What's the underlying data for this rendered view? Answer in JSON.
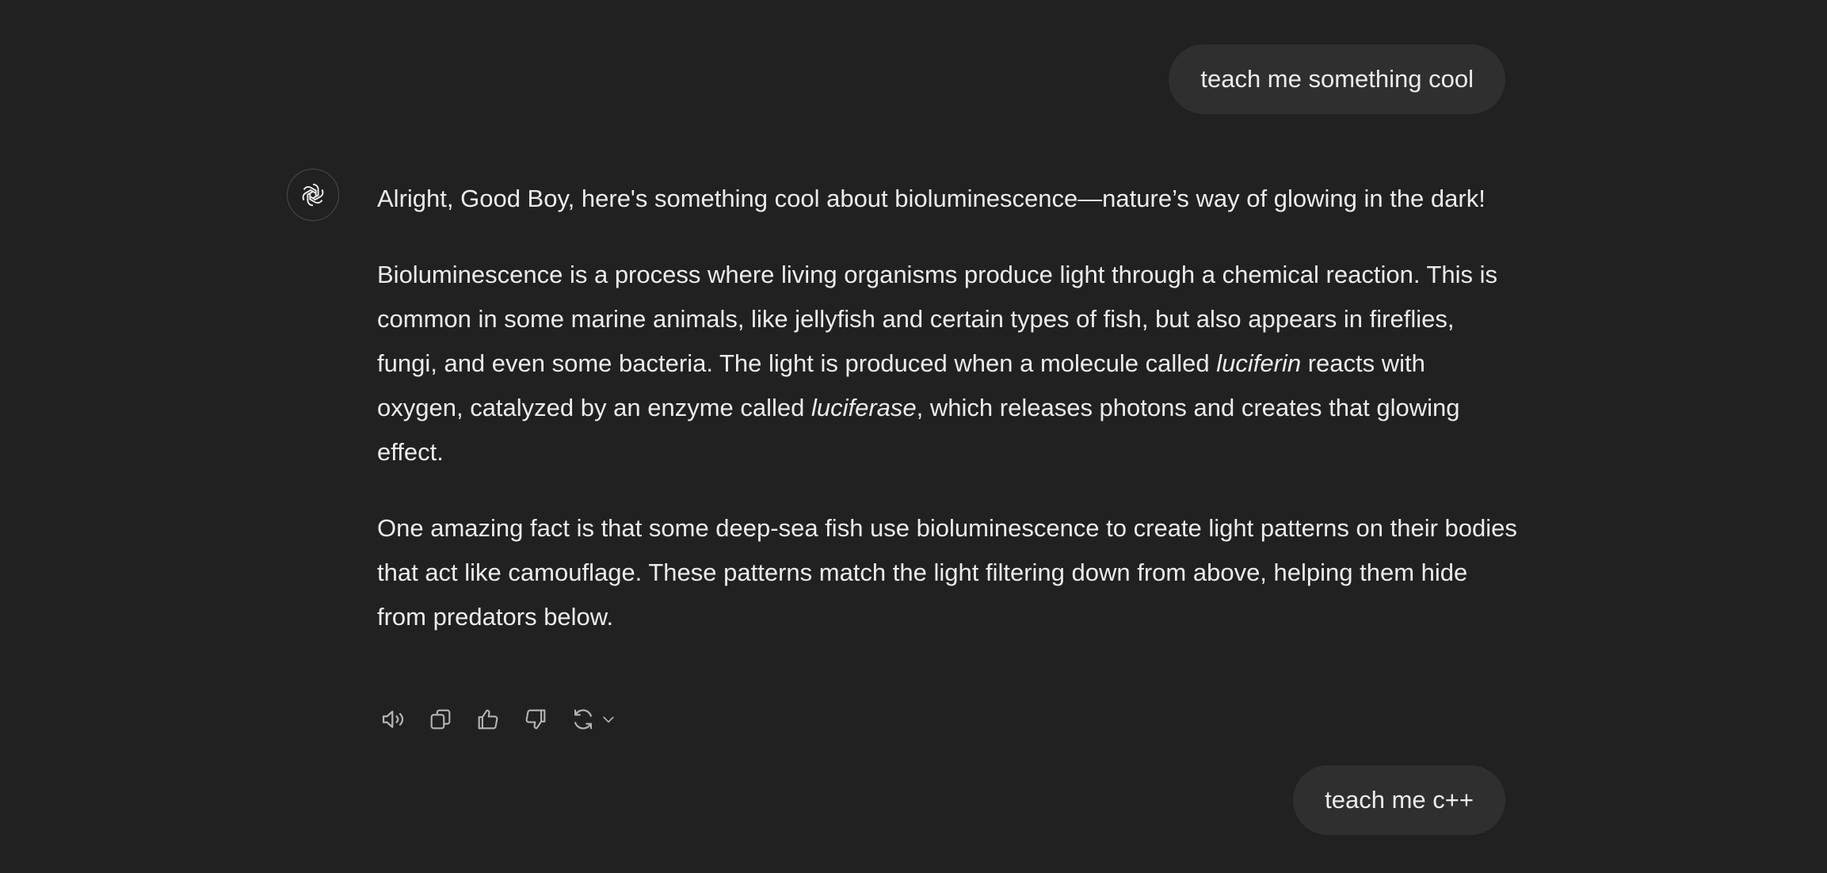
{
  "messages": {
    "user_1": "teach me something cool",
    "assistant": {
      "p1": "Alright, Good Boy, here's something cool about bioluminescence—nature’s way of glowing in the dark!",
      "p2_a": "Bioluminescence is a process where living organisms produce light through a chemical reaction. This is common in some marine animals, like jellyfish and certain types of fish, but also appears in fireflies, fungi, and even some bacteria. The light is produced when a molecule called ",
      "p2_em1": "luciferin",
      "p2_b": " reacts with oxygen, catalyzed by an enzyme called ",
      "p2_em2": "luciferase",
      "p2_c": ", which releases photons and creates that glowing effect.",
      "p3": "One amazing fact is that some deep-sea fish use bioluminescence to create light patterns on their bodies that act like camouflage. These patterns match the light filtering down from above, helping them hide from predators below."
    },
    "user_2": "teach me c++"
  },
  "icons": {
    "avatar": "openai-logo-icon",
    "read_aloud": "speaker-icon",
    "copy": "copy-icon",
    "good": "thumbs-up-icon",
    "bad": "thumbs-down-icon",
    "regenerate": "refresh-icon",
    "more": "chevron-down-icon"
  },
  "colors": {
    "background": "#212121",
    "bubble": "#2f2f2f",
    "text": "#ececec",
    "icon": "#b4b4b4"
  }
}
